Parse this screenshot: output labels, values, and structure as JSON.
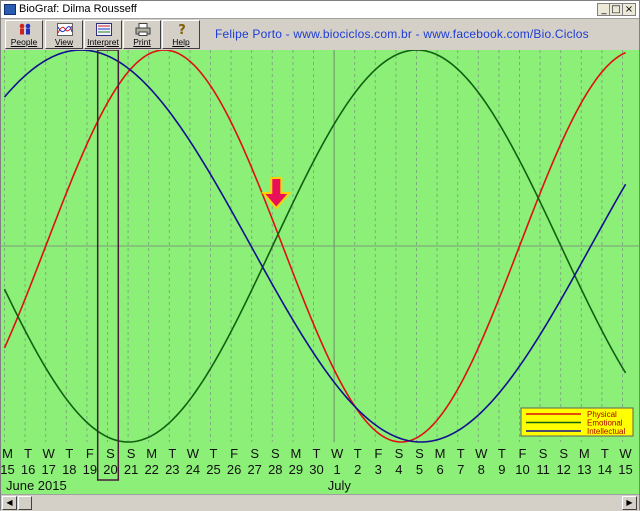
{
  "window": {
    "title": "BioGraf: Dilma Rousseff"
  },
  "titlebar_buttons": [
    {
      "name": "minimize-button",
      "label": "_"
    },
    {
      "name": "maximize-button",
      "label": "□"
    },
    {
      "name": "close-button",
      "label": "×"
    }
  ],
  "toolbar": {
    "buttons": [
      {
        "name": "people-button",
        "icon": "people-icon",
        "label": "People"
      },
      {
        "name": "view-button",
        "icon": "view-chart-icon",
        "label": "View"
      },
      {
        "name": "interpret-button",
        "icon": "interpret-icon",
        "label": "Interpret"
      },
      {
        "name": "print-button",
        "icon": "printer-icon",
        "label": "Print"
      },
      {
        "name": "help-button",
        "icon": "help-icon",
        "label": "Help"
      }
    ],
    "credit": "Felipe Porto - www.biociclos.com.br - www.facebook.com/Bio.Ciclos"
  },
  "chart_data": {
    "type": "line",
    "background": "#8cf078",
    "day_letters": [
      "M",
      "T",
      "W",
      "T",
      "F",
      "S",
      "S",
      "M",
      "T",
      "W",
      "T",
      "F",
      "S",
      "S",
      "M",
      "T",
      "W",
      "T",
      "F",
      "S",
      "S",
      "M",
      "T",
      "W",
      "T",
      "F",
      "S",
      "S",
      "M",
      "T",
      "W"
    ],
    "day_numbers": [
      "15",
      "16",
      "17",
      "18",
      "19",
      "20",
      "21",
      "22",
      "23",
      "24",
      "25",
      "26",
      "27",
      "28",
      "29",
      "30",
      "1",
      "2",
      "3",
      "4",
      "5",
      "6",
      "7",
      "8",
      "9",
      "10",
      "11",
      "12",
      "13",
      "14",
      "15"
    ],
    "months": [
      {
        "label": "June 2015",
        "start_index": 0
      },
      {
        "label": "July",
        "start_index": 16
      }
    ],
    "selected_day_index": 5,
    "marker_day_index": 13,
    "ylim": [
      -100,
      100
    ],
    "series": [
      {
        "name": "Physical",
        "color": "#e01010",
        "period_days": 23,
        "values": [
          -52,
          -26,
          0,
          27,
          52,
          73,
          89,
          98,
          100,
          94,
          82,
          63,
          40,
          14,
          -14,
          -40,
          -63,
          -82,
          -94,
          -100,
          -98,
          -89,
          -73,
          -52,
          -27,
          0,
          26,
          52,
          73,
          89,
          98
        ]
      },
      {
        "name": "Emotional",
        "color": "#106010",
        "period_days": 28,
        "values": [
          -22,
          -43,
          -62,
          -78,
          -90,
          -97,
          -100,
          -97,
          -90,
          -78,
          -62,
          -43,
          -22,
          0,
          22,
          43,
          62,
          78,
          90,
          97,
          100,
          97,
          90,
          78,
          62,
          43,
          22,
          0,
          -22,
          -43,
          -62
        ]
      },
      {
        "name": "Intellectual",
        "color": "#101090",
        "period_days": 33,
        "values": [
          76,
          89,
          97,
          100,
          98,
          91,
          79,
          63,
          45,
          24,
          3,
          -19,
          -39,
          -58,
          -74,
          -87,
          -96,
          -100,
          -99,
          -94,
          -83,
          -69,
          -52,
          -32,
          -10,
          11,
          32,
          52,
          69,
          83,
          94
        ]
      }
    ],
    "legend_position": "bottom-right",
    "legend_box_color": "#ffff00"
  }
}
